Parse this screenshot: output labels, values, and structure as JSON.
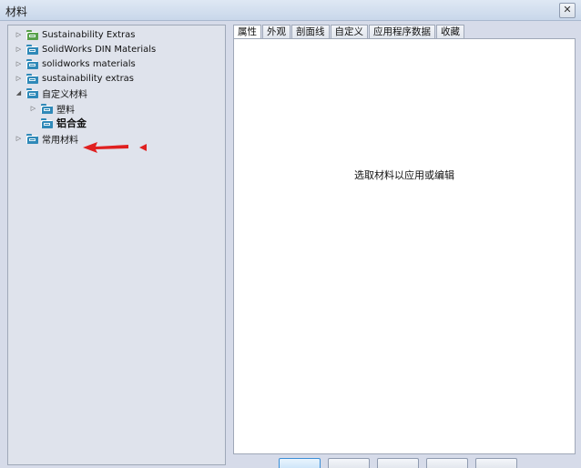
{
  "window": {
    "title": "材料",
    "close_symbol": "✕"
  },
  "tree": {
    "items": [
      {
        "label": "Sustainability Extras",
        "expander": "▷",
        "icon": "folder-green-icon",
        "bold": false
      },
      {
        "label": "SolidWorks DIN Materials",
        "expander": "▷",
        "icon": "folder-blue-icon",
        "bold": false
      },
      {
        "label": "solidworks materials",
        "expander": "▷",
        "icon": "folder-blue-icon",
        "bold": false
      },
      {
        "label": "sustainability extras",
        "expander": "▷",
        "icon": "folder-blue-icon",
        "bold": false
      },
      {
        "label": "自定义材料",
        "expander": "◢",
        "icon": "folder-blue-icon",
        "bold": false
      },
      {
        "label": "塑料",
        "expander": "▷",
        "icon": "folder-blue-icon",
        "bold": false
      },
      {
        "label": "铝合金",
        "expander": "",
        "icon": "folder-blue-icon",
        "bold": true
      },
      {
        "label": "常用材料",
        "expander": "▷",
        "icon": "folder-blue-icon",
        "bold": false
      }
    ],
    "annotation": {
      "icon": "red-arrow-icon",
      "color": "#e02020"
    }
  },
  "tabs": [
    {
      "label": "属性",
      "active": true
    },
    {
      "label": "外观",
      "active": false
    },
    {
      "label": "剖面线",
      "active": false
    },
    {
      "label": "自定义",
      "active": false
    },
    {
      "label": "应用程序数据",
      "active": false
    },
    {
      "label": "收藏",
      "active": false
    }
  ],
  "content": {
    "message": "选取材料以应用或编辑"
  },
  "colors": {
    "accent": "#3c8fd6",
    "folder_green": "#58a04a",
    "folder_blue": "#2f89b8"
  }
}
